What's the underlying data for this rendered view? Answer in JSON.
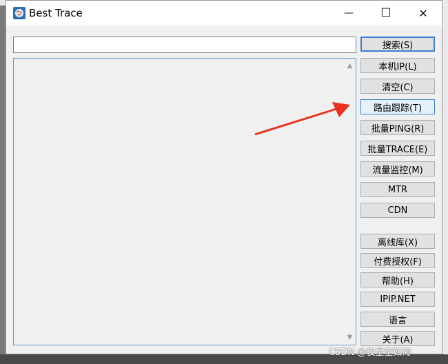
{
  "window": {
    "title": "Best Trace",
    "minimize_glyph": "—",
    "maximize_glyph": "☐",
    "close_glyph": "✕",
    "icon": "globe-app-icon"
  },
  "search": {
    "value": "",
    "placeholder": ""
  },
  "buttons": {
    "search": "搜索(S)",
    "local_ip": "本机IP(L)",
    "clear": "清空(C)",
    "route_trace": "路由跟踪(T)",
    "batch_ping": "批量PING(R)",
    "batch_trace": "批量TRACE(E)",
    "traffic_monitor": "流量监控(M)",
    "mtr": "MTR",
    "cdn": "CDN",
    "offline_db": "离线库(X)",
    "paid_license": "付费授权(F)",
    "help": "帮助(H)",
    "ipip": "IPIP.NET",
    "language": "语言",
    "about": "关于(A)"
  },
  "watermark": "CSDN @夜星空如海",
  "colors": {
    "accent": "#3c7fd1",
    "annotation_arrow": "#e8321e"
  }
}
